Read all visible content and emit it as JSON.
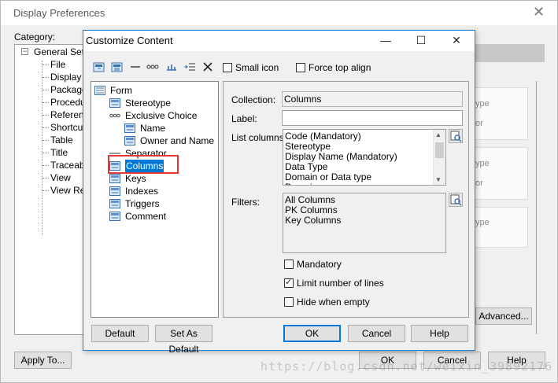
{
  "background_window": {
    "title": "Display Preferences",
    "category_label": "Category:",
    "tree": {
      "root": "General Setti",
      "items": [
        "File",
        "Display Sym",
        "Package",
        "Procedur",
        "Referenc",
        "Shortcut",
        "Table",
        "Title",
        "Traceabi",
        "View",
        "View Ref"
      ]
    },
    "faint_texts": [
      "ype",
      "or",
      "ype",
      "or",
      "ype"
    ],
    "advanced_button": "Advanced...",
    "apply_to_button": "Apply To...",
    "ok_button": "OK",
    "cancel_button": "Cancel",
    "help_button": "Help",
    "watermark": "https://blog.csdn.net/weixin_39892176"
  },
  "dialog": {
    "title": "Customize Content",
    "toolbar": {
      "small_icon_label": "Small icon",
      "force_top_align_label": "Force top align"
    },
    "tree": {
      "items": [
        {
          "label": "Form",
          "icon": "form-icon"
        },
        {
          "label": "Stereotype",
          "icon": "attribute-icon"
        },
        {
          "label": "Exclusive Choice",
          "icon": "choice-icon"
        },
        {
          "label": "Name",
          "icon": "attribute-icon"
        },
        {
          "label": "Owner and Name",
          "icon": "attribute-icon"
        },
        {
          "label": "Separator",
          "icon": "separator-icon"
        },
        {
          "label": "Columns",
          "icon": "attribute-icon"
        },
        {
          "label": "Keys",
          "icon": "attribute-icon"
        },
        {
          "label": "Indexes",
          "icon": "attribute-icon"
        },
        {
          "label": "Triggers",
          "icon": "attribute-icon"
        },
        {
          "label": "Comment",
          "icon": "attribute-icon"
        }
      ],
      "selected": "Columns"
    },
    "properties": {
      "collection_label": "Collection:",
      "collection_value": "Columns",
      "label_label": "Label:",
      "label_value": "",
      "list_columns_label": "List columns:",
      "list_columns": [
        "Code (Mandatory)",
        "Stereotype",
        "Display Name (Mandatory)",
        "Data Type",
        "Domain or Data type",
        "Domain"
      ],
      "filters_label": "Filters:",
      "filters": [
        "All Columns",
        "PK Columns",
        "Key Columns"
      ],
      "mandatory_label": "Mandatory",
      "limit_lines_label": "Limit number of lines",
      "hide_when_empty_label": "Hide when empty"
    },
    "buttons": {
      "default": "Default",
      "set_as_default": "Set As Default",
      "ok": "OK",
      "cancel": "Cancel",
      "help": "Help"
    },
    "states": {
      "small_icon": false,
      "force_top_align": false,
      "mandatory": false,
      "limit_number_of_lines": true,
      "hide_when_empty": false
    }
  },
  "colors": {
    "accent": "#0078d7",
    "highlight_box": "#e53935",
    "dialog_bg": "#f0f0f0"
  }
}
